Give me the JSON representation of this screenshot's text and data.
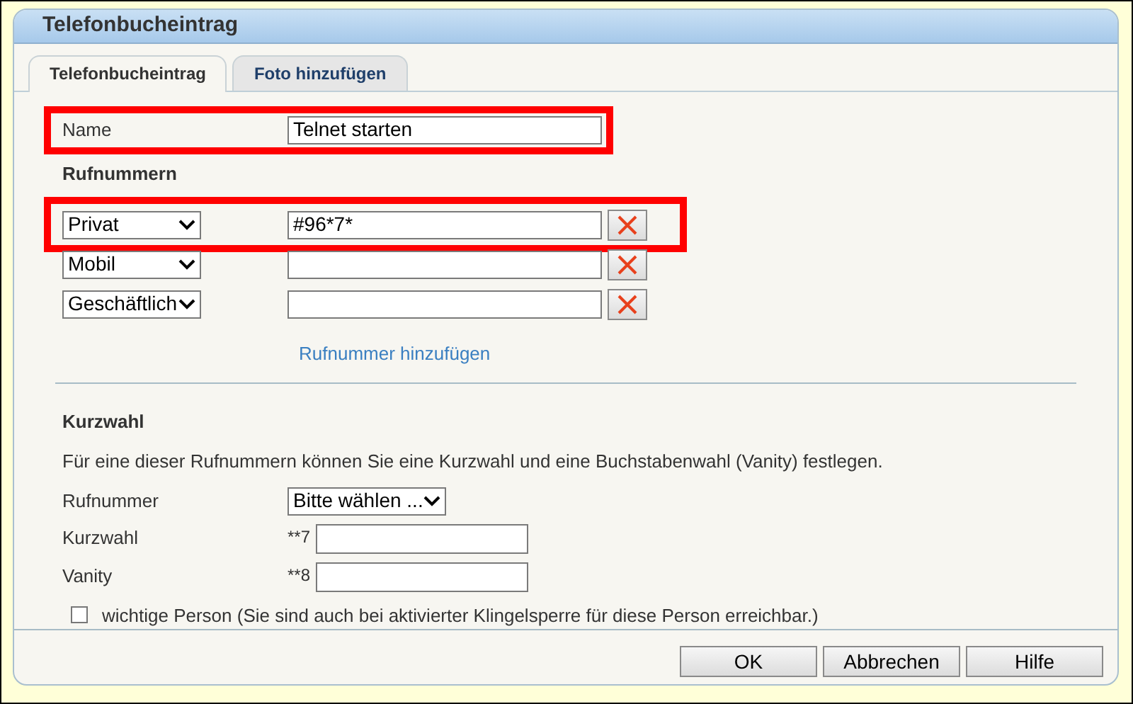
{
  "window": {
    "title": "Telefonbucheintrag"
  },
  "tabs": [
    {
      "label": "Telefonbucheintrag",
      "selected": true
    },
    {
      "label": "Foto hinzufügen",
      "selected": false
    }
  ],
  "name": {
    "label": "Name",
    "value": "Telnet starten",
    "highlighted": true
  },
  "numbers": {
    "heading": "Rufnummern",
    "rows": [
      {
        "type": "Privat",
        "value": "#96*7*",
        "highlighted": true
      },
      {
        "type": "Mobil",
        "value": "",
        "highlighted": false
      },
      {
        "type": "Geschäftlich",
        "value": "",
        "highlighted": false
      }
    ],
    "add_link": "Rufnummer hinzufügen"
  },
  "speed_dial": {
    "heading": "Kurzwahl",
    "description": "Für eine dieser Rufnummern können Sie eine Kurzwahl und eine Buchstabenwahl (Vanity) festlegen.",
    "number": {
      "label": "Rufnummer",
      "value": "Bitte wählen ..."
    },
    "kurzwahl": {
      "label": "Kurzwahl",
      "prefix": "**7"
    },
    "vanity": {
      "label": "Vanity",
      "prefix": "**8"
    },
    "important": {
      "label": "wichtige Person (Sie sind auch bei aktivierter Klingelsperre für diese Person erreichbar.)",
      "checked": false
    }
  },
  "buttons": [
    "OK",
    "Abbrechen",
    "Hilfe"
  ]
}
